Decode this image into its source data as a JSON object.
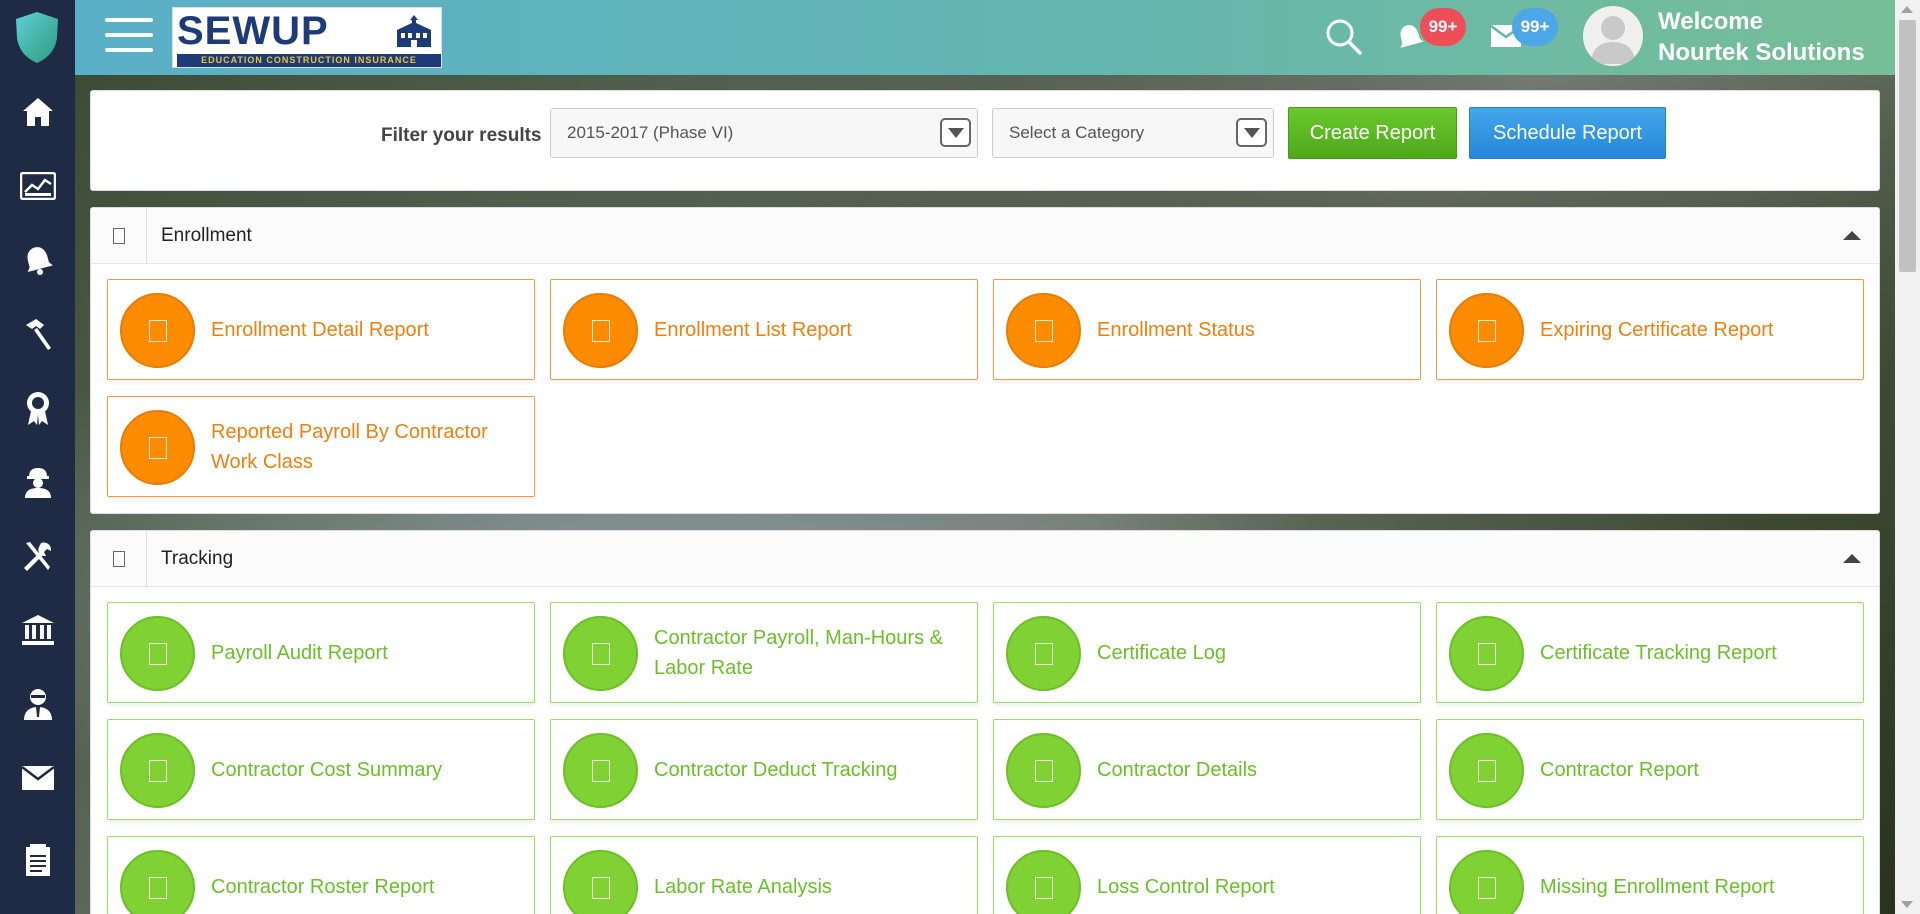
{
  "header": {
    "brand_name": "SEWUP",
    "brand_tagline": "EDUCATION CONSTRUCTION INSURANCE",
    "notifications_badge": "99+",
    "messages_badge": "99+",
    "welcome_line1": "Welcome",
    "welcome_line2": "Nourtek Solutions"
  },
  "sidebar": {
    "items": [
      {
        "icon": "home-icon"
      },
      {
        "icon": "dashboard-chart-icon"
      },
      {
        "icon": "bell-icon"
      },
      {
        "icon": "hammer-icon"
      },
      {
        "icon": "award-ribbon-icon"
      },
      {
        "icon": "worker-icon"
      },
      {
        "icon": "tools-icon"
      },
      {
        "icon": "bank-icon"
      },
      {
        "icon": "user-profile-icon"
      },
      {
        "icon": "mail-icon"
      },
      {
        "icon": "document-icon"
      }
    ]
  },
  "filter": {
    "label": "Filter your results",
    "phase_select": "2015-2017 (Phase VI)",
    "category_select": "Select a Category",
    "create_button": "Create Report",
    "schedule_button": "Schedule Report"
  },
  "sections": [
    {
      "title": "Enrollment",
      "color": "#ff8c00",
      "cards": [
        "Enrollment Detail Report",
        "Enrollment List Report",
        "Enrollment Status",
        "Expiring Certificate Report",
        "Reported Payroll By Contractor Work Class"
      ]
    },
    {
      "title": "Tracking",
      "color": "#7fd134",
      "cards": [
        "Payroll Audit Report",
        "Contractor Payroll, Man-Hours & Labor Rate",
        "Certificate Log",
        "Certificate Tracking Report",
        "Contractor Cost Summary",
        "Contractor Deduct Tracking",
        "Contractor Details",
        "Contractor Report",
        "Contractor Roster Report",
        "Labor Rate Analysis",
        "Loss Control Report",
        "Missing Enrollment Report"
      ]
    }
  ],
  "colors": {
    "sidebar": "#1f2a44",
    "create_button": "#5cb823",
    "schedule_button": "#2f93df",
    "enrollment_accent": "#ff8c00",
    "tracking_accent": "#7fd134"
  }
}
